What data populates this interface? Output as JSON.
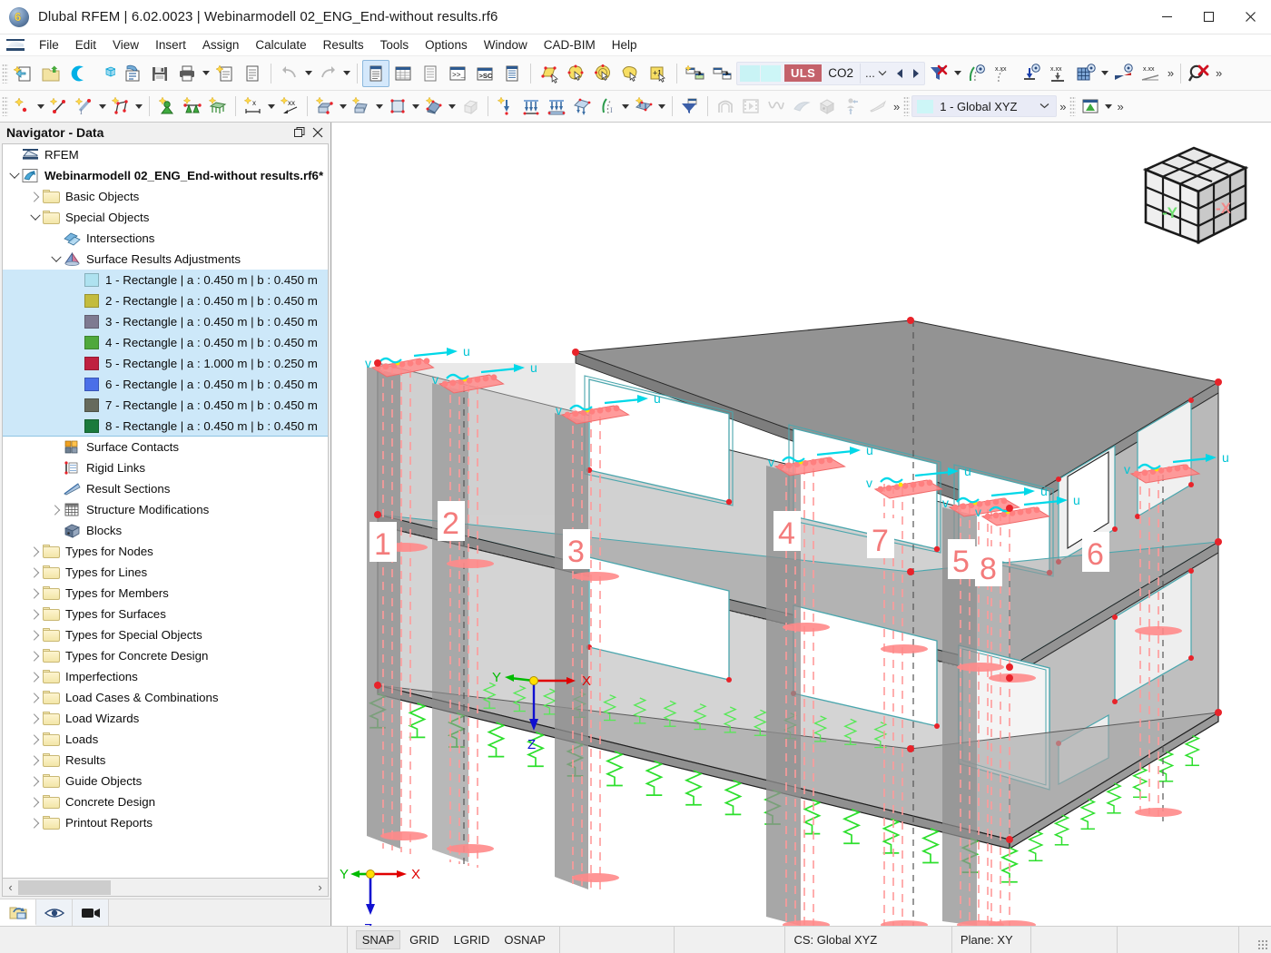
{
  "window": {
    "title": "Dlubal RFEM | 6.02.0023 | Webinarmodell 02_ENG_End-without results.rf6",
    "app_icon": "dlubal-rfem-logo-icon",
    "minimize_label": "─",
    "maximize_label": "☐",
    "close_label": "✕"
  },
  "menubar": {
    "items": [
      {
        "label": "File",
        "name": "menu-file"
      },
      {
        "label": "Edit",
        "name": "menu-edit"
      },
      {
        "label": "View",
        "name": "menu-view"
      },
      {
        "label": "Insert",
        "name": "menu-insert"
      },
      {
        "label": "Assign",
        "name": "menu-assign"
      },
      {
        "label": "Calculate",
        "name": "menu-calculate"
      },
      {
        "label": "Results",
        "name": "menu-results"
      },
      {
        "label": "Tools",
        "name": "menu-tools"
      },
      {
        "label": "Options",
        "name": "menu-options"
      },
      {
        "label": "Window",
        "name": "menu-window"
      },
      {
        "label": "CAD-BIM",
        "name": "menu-cad-bim"
      },
      {
        "label": "Help",
        "name": "menu-help"
      }
    ]
  },
  "toolbar_main": {
    "uls_badge": "ULS",
    "co2_label": "CO2",
    "ellipsis": "...",
    "overflow": "»",
    "value_labels": [
      "x.xx",
      "x.xx",
      "x.xx"
    ]
  },
  "toolbar_secondary": {
    "cs_selector": {
      "value": "1 - Global XYZ",
      "swatch_color": "#cdf6f7"
    },
    "overflow": "»"
  },
  "navigator": {
    "title": "Navigator - Data",
    "restore_label": "❐",
    "close_label": "✕",
    "scroll_left": "‹",
    "scroll_right": "›",
    "tabs": [
      {
        "name": "nav-tab-data",
        "icon": "data-navigator-icon",
        "selected": true
      },
      {
        "name": "nav-tab-display",
        "icon": "eye-icon",
        "selected": false
      },
      {
        "name": "nav-tab-views",
        "icon": "camera-icon",
        "selected": false
      }
    ],
    "tree": [
      {
        "label": "RFEM",
        "depth": 0,
        "icon": "rfem-logo-icon",
        "expander": "none",
        "bold": false
      },
      {
        "label": "Webinarmodell 02_ENG_End-without results.rf6*",
        "depth": 0,
        "icon": "model-icon",
        "expander": "open",
        "bold": true
      },
      {
        "label": "Basic Objects",
        "depth": 1,
        "icon": "folder-icon",
        "expander": "closed",
        "bold": false
      },
      {
        "label": "Special Objects",
        "depth": 1,
        "icon": "folder-icon",
        "expander": "open",
        "bold": false
      },
      {
        "label": "Intersections",
        "depth": 2,
        "icon": "intersections-icon",
        "expander": "none",
        "bold": false
      },
      {
        "label": "Surface Results Adjustments",
        "depth": 2,
        "icon": "surface-results-adjustment-icon",
        "expander": "open",
        "bold": false
      },
      {
        "label": "1 - Rectangle | a : 0.450 m | b : 0.450 m",
        "depth": 3,
        "icon": "color-swatch",
        "swatch": "#aee2f0",
        "selected": true,
        "expander": "none"
      },
      {
        "label": "2 - Rectangle | a : 0.450 m | b : 0.450 m",
        "depth": 3,
        "icon": "color-swatch",
        "swatch": "#c3bc3e",
        "selected": true,
        "expander": "none"
      },
      {
        "label": "3 - Rectangle | a : 0.450 m | b : 0.450 m",
        "depth": 3,
        "icon": "color-swatch",
        "swatch": "#7e7a91",
        "selected": true,
        "expander": "none"
      },
      {
        "label": "4 - Rectangle | a : 0.450 m | b : 0.450 m",
        "depth": 3,
        "icon": "color-swatch",
        "swatch": "#4fa83c",
        "selected": true,
        "expander": "none"
      },
      {
        "label": "5 - Rectangle | a : 1.000 m | b : 0.250 m",
        "depth": 3,
        "icon": "color-swatch",
        "swatch": "#bf2140",
        "selected": true,
        "expander": "none"
      },
      {
        "label": "6 - Rectangle | a : 0.450 m | b : 0.450 m",
        "depth": 3,
        "icon": "color-swatch",
        "swatch": "#4a6fe8",
        "selected": true,
        "expander": "none"
      },
      {
        "label": "7 - Rectangle | a : 0.450 m | b : 0.450 m",
        "depth": 3,
        "icon": "color-swatch",
        "swatch": "#666a5c",
        "selected": true,
        "expander": "none"
      },
      {
        "label": "8 - Rectangle | a : 0.450 m | b : 0.450 m",
        "depth": 3,
        "icon": "color-swatch",
        "swatch": "#1b7a3c",
        "selected": true,
        "expander": "none"
      },
      {
        "label": "Surface Contacts",
        "depth": 2,
        "icon": "surface-contacts-icon",
        "expander": "none",
        "bold": false
      },
      {
        "label": "Rigid Links",
        "depth": 2,
        "icon": "rigid-links-icon",
        "expander": "none",
        "bold": false
      },
      {
        "label": "Result Sections",
        "depth": 2,
        "icon": "result-sections-icon",
        "expander": "none",
        "bold": false
      },
      {
        "label": "Structure Modifications",
        "depth": 2,
        "icon": "structure-modifications-icon",
        "expander": "closed",
        "bold": false
      },
      {
        "label": "Blocks",
        "depth": 2,
        "icon": "blocks-icon",
        "expander": "none",
        "bold": false
      },
      {
        "label": "Types for Nodes",
        "depth": 1,
        "icon": "folder-icon",
        "expander": "closed",
        "bold": false
      },
      {
        "label": "Types for Lines",
        "depth": 1,
        "icon": "folder-icon",
        "expander": "closed",
        "bold": false
      },
      {
        "label": "Types for Members",
        "depth": 1,
        "icon": "folder-icon",
        "expander": "closed",
        "bold": false
      },
      {
        "label": "Types for Surfaces",
        "depth": 1,
        "icon": "folder-icon",
        "expander": "closed",
        "bold": false
      },
      {
        "label": "Types for Special Objects",
        "depth": 1,
        "icon": "folder-icon",
        "expander": "closed",
        "bold": false
      },
      {
        "label": "Types for Concrete Design",
        "depth": 1,
        "icon": "folder-icon",
        "expander": "closed",
        "bold": false
      },
      {
        "label": "Imperfections",
        "depth": 1,
        "icon": "folder-icon",
        "expander": "closed",
        "bold": false
      },
      {
        "label": "Load Cases & Combinations",
        "depth": 1,
        "icon": "folder-icon",
        "expander": "closed",
        "bold": false
      },
      {
        "label": "Load Wizards",
        "depth": 1,
        "icon": "folder-icon",
        "expander": "closed",
        "bold": false
      },
      {
        "label": "Loads",
        "depth": 1,
        "icon": "folder-icon",
        "expander": "closed",
        "bold": false
      },
      {
        "label": "Results",
        "depth": 1,
        "icon": "folder-icon",
        "expander": "closed",
        "bold": false
      },
      {
        "label": "Guide Objects",
        "depth": 1,
        "icon": "folder-icon",
        "expander": "closed",
        "bold": false
      },
      {
        "label": "Concrete Design",
        "depth": 1,
        "icon": "folder-icon",
        "expander": "closed",
        "bold": false
      },
      {
        "label": "Printout Reports",
        "depth": 1,
        "icon": "folder-icon",
        "expander": "closed",
        "bold": false
      }
    ]
  },
  "viewport": {
    "view_cube": {
      "face_left_label": "-Y",
      "face_right_label": "-X",
      "left_color": "#66dd66",
      "right_color": "#f09a9a"
    },
    "axes_origin": {
      "x_label": "X",
      "y_label": "Y",
      "z_label": "Z"
    },
    "axes_corner": {
      "x_label": "X",
      "y_label": "Y",
      "z_label": "Z"
    },
    "surface_adjustment_labels": [
      "1",
      "2",
      "3",
      "4",
      "5",
      "6",
      "7",
      "8"
    ],
    "local_axis_labels": {
      "u": "u",
      "v": "v"
    },
    "colors": {
      "node": "#e8232a",
      "support": "#33dd33",
      "adjustment": "#ff8b8b",
      "edge_cyan": "#4aa6ad",
      "label_red": "#f37b7b"
    }
  },
  "statusbar": {
    "snap": "SNAP",
    "grid": "GRID",
    "lgrid": "LGRID",
    "osnap": "OSNAP",
    "cs": "CS: Global XYZ",
    "plane": "Plane: XY",
    "field_a": "",
    "field_b": "",
    "field_c": "",
    "field_d": ""
  }
}
